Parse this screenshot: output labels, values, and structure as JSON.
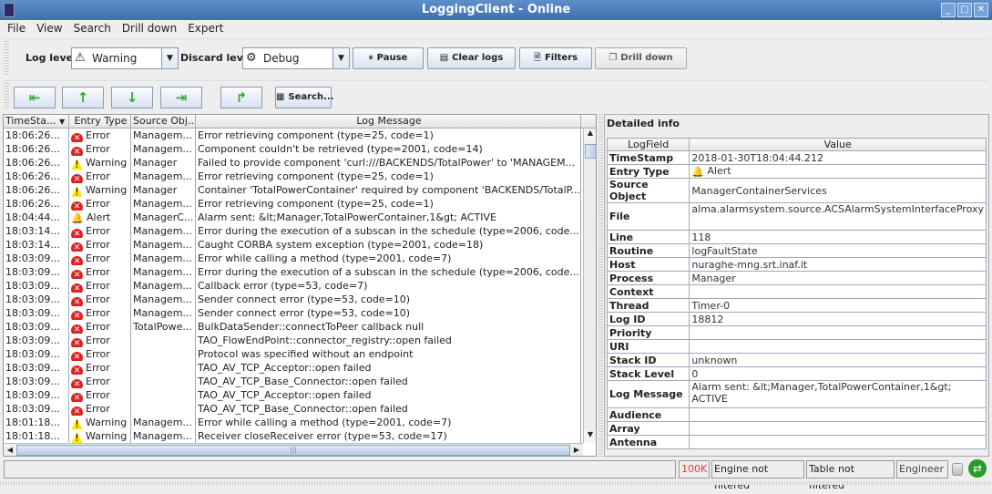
{
  "window": {
    "title": "LoggingClient - Online"
  },
  "menu": [
    "File",
    "View",
    "Search",
    "Drill down",
    "Expert"
  ],
  "toolbar": {
    "log_level_label": "Log level:",
    "log_level_value": "Warning",
    "discard_level_label": "Discard level:",
    "discard_level_value": "Debug",
    "pause": "Pause",
    "clear_logs": "Clear logs",
    "filters": "Filters",
    "drill_down": "Drill down",
    "search": "Search..."
  },
  "table": {
    "columns": [
      "TimeSta...",
      "Entry Type",
      "Source Obj...",
      "Log Message"
    ],
    "rows": [
      [
        "18:06:26...",
        "Error",
        "Managem...",
        "Error retrieving component (type=25, code=1)"
      ],
      [
        "18:06:26...",
        "Error",
        "Managem...",
        "Component couldn't be retrieved (type=2001, code=14)"
      ],
      [
        "18:06:26...",
        "Warning",
        "Manager",
        "Failed to provide component 'curl:///BACKENDS/TotalPower' to 'MANAGEM..."
      ],
      [
        "18:06:26...",
        "Error",
        "Managem...",
        "Error retrieving component (type=25, code=1)"
      ],
      [
        "18:06:26...",
        "Warning",
        "Manager",
        "Container 'TotalPowerContainer' required by component 'BACKENDS/TotalP..."
      ],
      [
        "18:06:26...",
        "Error",
        "Managem...",
        "Error retrieving component (type=25, code=1)"
      ],
      [
        "18:04:44...",
        "Alert",
        "ManagerC...",
        "Alarm sent: &lt;Manager,TotalPowerContainer,1&gt; ACTIVE"
      ],
      [
        "18:03:14...",
        "Error",
        "Managem...",
        "Error during the execution of a subscan in the schedule (type=2006, code..."
      ],
      [
        "18:03:14...",
        "Error",
        "Managem...",
        "Caught CORBA system exception (type=2001, code=18)"
      ],
      [
        "18:03:09...",
        "Error",
        "Managem...",
        "Error while calling a method (type=2001, code=7)"
      ],
      [
        "18:03:09...",
        "Error",
        "Managem...",
        "Error during the execution of a subscan in the schedule (type=2006, code..."
      ],
      [
        "18:03:09...",
        "Error",
        "Managem...",
        "Callback error (type=53, code=7)"
      ],
      [
        "18:03:09...",
        "Error",
        "Managem...",
        "Sender connect error (type=53, code=10)"
      ],
      [
        "18:03:09...",
        "Error",
        "Managem...",
        "Sender connect error (type=53, code=10)"
      ],
      [
        "18:03:09...",
        "Error",
        "TotalPowe...",
        "BulkDataSender::connectToPeer callback null"
      ],
      [
        "18:03:09...",
        "Error",
        "",
        "TAO_FlowEndPoint::connector_registry::open failed"
      ],
      [
        "18:03:09...",
        "Error",
        "",
        "Protocol was specified without an endpoint"
      ],
      [
        "18:03:09...",
        "Error",
        "",
        "TAO_AV_TCP_Acceptor::open failed"
      ],
      [
        "18:03:09...",
        "Error",
        "",
        "TAO_AV_TCP_Base_Connector::open failed"
      ],
      [
        "18:03:09...",
        "Error",
        "",
        "TAO_AV_TCP_Acceptor::open failed"
      ],
      [
        "18:03:09...",
        "Error",
        "",
        "TAO_AV_TCP_Base_Connector::open failed"
      ],
      [
        "18:01:18...",
        "Warning",
        "Managem...",
        "Error while calling a method (type=2001, code=7)"
      ],
      [
        "18:01:18...",
        "Warning",
        "Managem...",
        "Receiver closeReceiver error (type=53, code=17)"
      ]
    ]
  },
  "detail": {
    "title": "Detailed info",
    "columns": [
      "LogField",
      "Value"
    ],
    "fields": [
      [
        "TimeStamp",
        "2018-01-30T18:04:44.212"
      ],
      [
        "Entry Type",
        "Alert"
      ],
      [
        "Source Object",
        "ManagerContainerServices"
      ],
      [
        "File",
        "alma.alarmsystem.source.ACSAlarmSystemInterfaceProxy"
      ],
      [
        "Line",
        "118"
      ],
      [
        "Routine",
        "logFaultState"
      ],
      [
        "Host",
        "nuraghe-mng.srt.inaf.it"
      ],
      [
        "Process",
        "Manager"
      ],
      [
        "Context",
        ""
      ],
      [
        "Thread",
        "Timer-0"
      ],
      [
        "Log ID",
        "18812"
      ],
      [
        "Priority",
        ""
      ],
      [
        "URI",
        ""
      ],
      [
        "Stack ID",
        "unknown"
      ],
      [
        "Stack Level",
        "0"
      ],
      [
        "Log Message",
        "Alarm sent: &lt;Manager,TotalPowerContainer,1&gt; ACTIVE"
      ],
      [
        "Audience",
        ""
      ],
      [
        "Array",
        ""
      ],
      [
        "Antenna",
        ""
      ]
    ]
  },
  "status": {
    "memory": "100K",
    "engine": "Engine not filtered",
    "table": "Table not filtered",
    "mode": "Engineer"
  },
  "colors": {
    "title_bar": "#4a7dbd",
    "memory_text": "#ff3333",
    "connected": "#2a9a2a"
  }
}
